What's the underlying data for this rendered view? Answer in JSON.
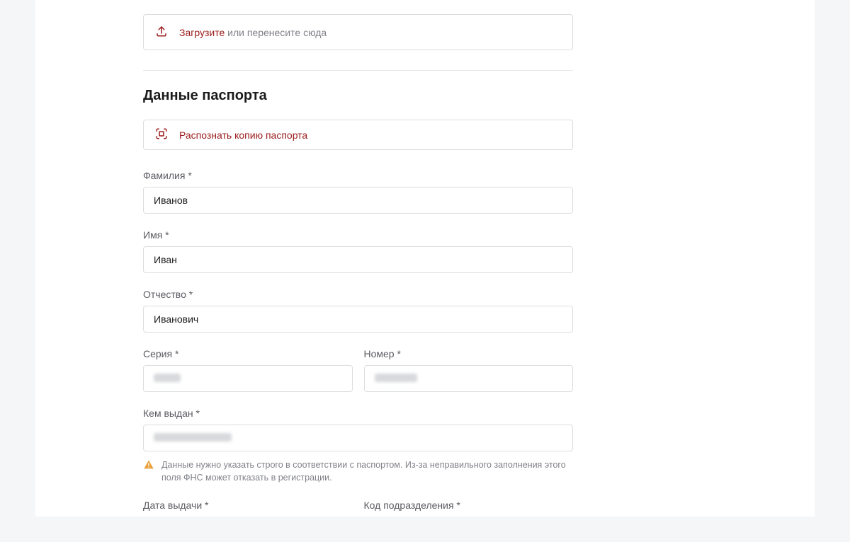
{
  "upload": {
    "action_label": "Загрузите",
    "rest_label": " или перенесите сюда"
  },
  "section": {
    "title": "Данные паспорта"
  },
  "recognize": {
    "label": "Распознать копию паспорта"
  },
  "fields": {
    "surname": {
      "label": "Фамилия *",
      "value": "Иванов"
    },
    "name": {
      "label": "Имя *",
      "value": "Иван"
    },
    "patronymic": {
      "label": "Отчество *",
      "value": "Иванович"
    },
    "series": {
      "label": "Серия *"
    },
    "number": {
      "label": "Номер *"
    },
    "issued_by": {
      "label": "Кем выдан *"
    },
    "issue_date": {
      "label": "Дата выдачи *"
    },
    "dept_code": {
      "label": "Код подразделения *"
    }
  },
  "alert": {
    "text": "Данные нужно указать строго в соответствии с паспортом. Из-за неправильного заполнения этого поля ФНС может отказать в регистрации."
  }
}
